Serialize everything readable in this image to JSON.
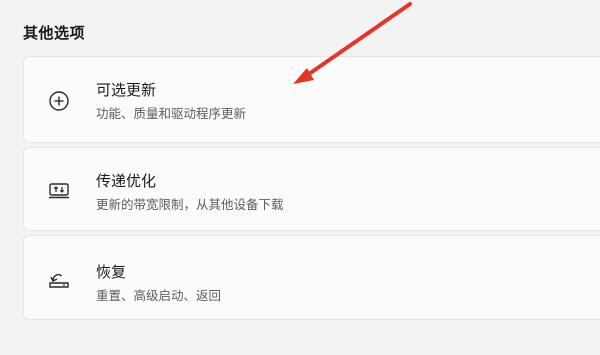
{
  "section": {
    "title": "其他选项"
  },
  "options": [
    {
      "title": "可选更新",
      "subtitle": "功能、质量和驱动程序更新",
      "icon": "add-circle-icon"
    },
    {
      "title": "传递优化",
      "subtitle": "更新的带宽限制，从其他设备下载",
      "icon": "delivery-optimization-icon"
    },
    {
      "title": "恢复",
      "subtitle": "重置、高级启动、返回",
      "icon": "recovery-icon"
    }
  ],
  "annotation": {
    "arrow_color": "#e53527"
  }
}
